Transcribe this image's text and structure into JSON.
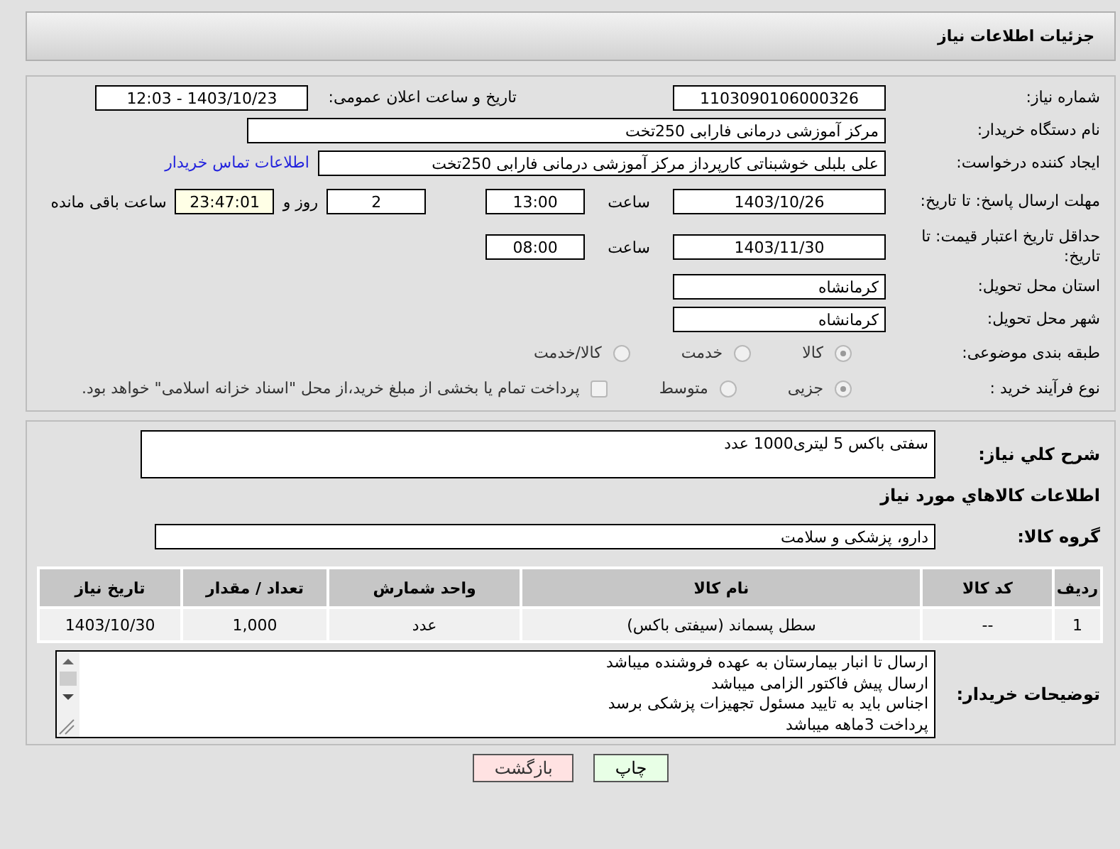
{
  "header": {
    "title": "جزئیات اطلاعات نیاز"
  },
  "need_number": {
    "label": "شماره نیاز:",
    "value": "1103090106000326"
  },
  "announce": {
    "label": "تاریخ و ساعت اعلان عمومی:",
    "value": "1403/10/23 - 12:03"
  },
  "buyer_org": {
    "label": "نام دستگاه خریدار:",
    "value": "مرکز آموزشی  درمانی فارابی 250تخت"
  },
  "requester": {
    "label": "ایجاد کننده درخواست:",
    "value": "علی بلبلی خوشبناتی کارپرداز مرکز آموزشی  درمانی فارابی 250تخت",
    "link": "اطلاعات تماس خریدار"
  },
  "reply_deadline": {
    "label": "مهلت ارسال پاسخ: تا تاریخ:",
    "date": "1403/10/26",
    "time_label": "ساعت",
    "time": "13:00",
    "days": "2",
    "days_label": "روز و",
    "remaining": "23:47:01",
    "remaining_label": "ساعت باقی مانده"
  },
  "price_validity": {
    "label": "حداقل تاریخ اعتبار قیمت: تا تاریخ:",
    "date": "1403/11/30",
    "time_label": "ساعت",
    "time": "08:00"
  },
  "province": {
    "label": "استان محل تحویل:",
    "value": "کرمانشاه"
  },
  "city": {
    "label": "شهر محل تحویل:",
    "value": "کرمانشاه"
  },
  "category": {
    "label": "طبقه بندی موضوعی:",
    "options": [
      {
        "label": "کالا",
        "selected": true
      },
      {
        "label": "خدمت",
        "selected": false
      },
      {
        "label": "کالا/خدمت",
        "selected": false
      }
    ]
  },
  "purchase_type": {
    "label": "نوع فرآیند خرید :",
    "options": [
      {
        "label": "جزیی",
        "selected": true
      },
      {
        "label": "متوسط",
        "selected": false
      }
    ],
    "checkbox": {
      "label": "پرداخت تمام یا بخشی از مبلغ خرید،از محل \"اسناد خزانه اسلامی\" خواهد بود.",
      "checked": false
    }
  },
  "description": {
    "label": "شرح کلي نياز:",
    "value": "سفتی باکس 5 لیتری1000 عدد"
  },
  "goods_heading": "اطلاعات کالاهاي مورد نياز",
  "goods_group": {
    "label": "گروه کالا:",
    "value": "دارو، پزشکی و سلامت"
  },
  "table": {
    "columns": [
      "ردیف",
      "کد کالا",
      "نام کالا",
      "واحد شمارش",
      "تعداد / مقدار",
      "تاریخ نیاز"
    ],
    "rows": [
      [
        "1",
        "--",
        "سطل پسماند (سیفتی باکس)",
        "عدد",
        "1,000",
        "1403/10/30"
      ]
    ]
  },
  "buyer_notes": {
    "label": "توضیحات خریدار:",
    "lines": [
      "ارسال تا انبار بیمارستان به عهده فروشنده میباشد",
      "ارسال پیش فاکتور الزامی میباشد",
      "اجناس باید به تایید مسئول تجهیزات پزشکی برسد",
      "پرداخت 3ماهه میباشد"
    ]
  },
  "buttons": [
    {
      "label": "چاپ",
      "kind": "print"
    },
    {
      "label": "بازگشت",
      "kind": "back"
    }
  ]
}
